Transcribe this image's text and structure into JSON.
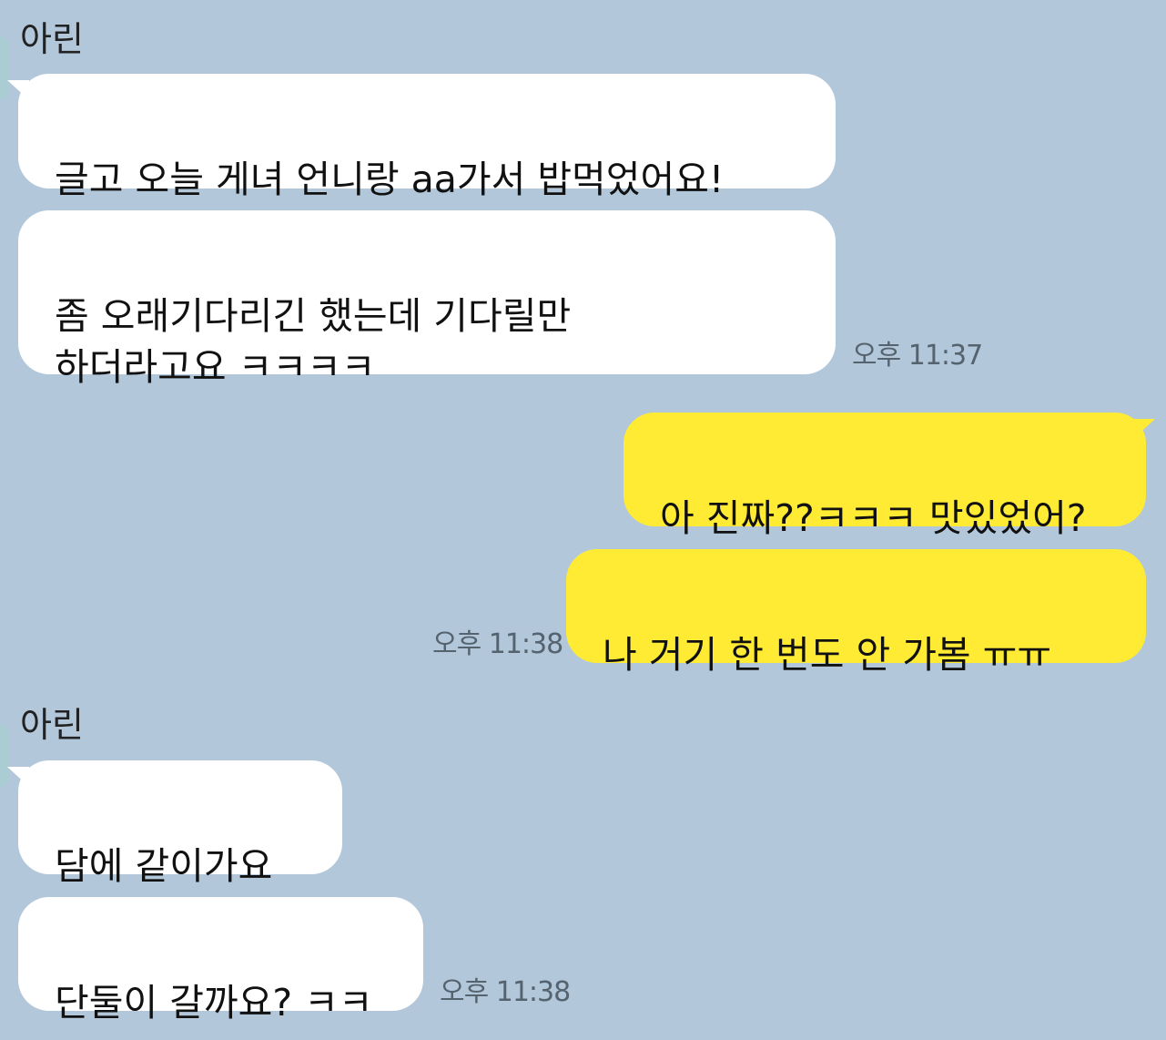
{
  "chat": {
    "messages": [
      {
        "sender": "아린",
        "text": "글고 오늘 게녀 언니랑 aa가서 밥먹었어요!"
      },
      {
        "sender": "아린",
        "text": "좀 오래기다리긴 했는데 기다릴만\n하더라고요 ㅋㅋㅋㅋ",
        "time": "오후 11:37"
      },
      {
        "sender": "me",
        "text": "아 진짜??ㅋㅋㅋ 맛있었어?"
      },
      {
        "sender": "me",
        "text": "나 거기 한 번도 안 가봄 ㅠㅠ",
        "time": "오후 11:38"
      },
      {
        "sender": "아린",
        "text": "담에 같이가요"
      },
      {
        "sender": "아린",
        "text": "단둘이 갈까요? ㅋㅋ",
        "time": "오후 11:38"
      }
    ]
  },
  "colors": {
    "background": "#b2c7da",
    "incoming_bubble": "#ffffff",
    "outgoing_bubble": "#ffeb33"
  }
}
